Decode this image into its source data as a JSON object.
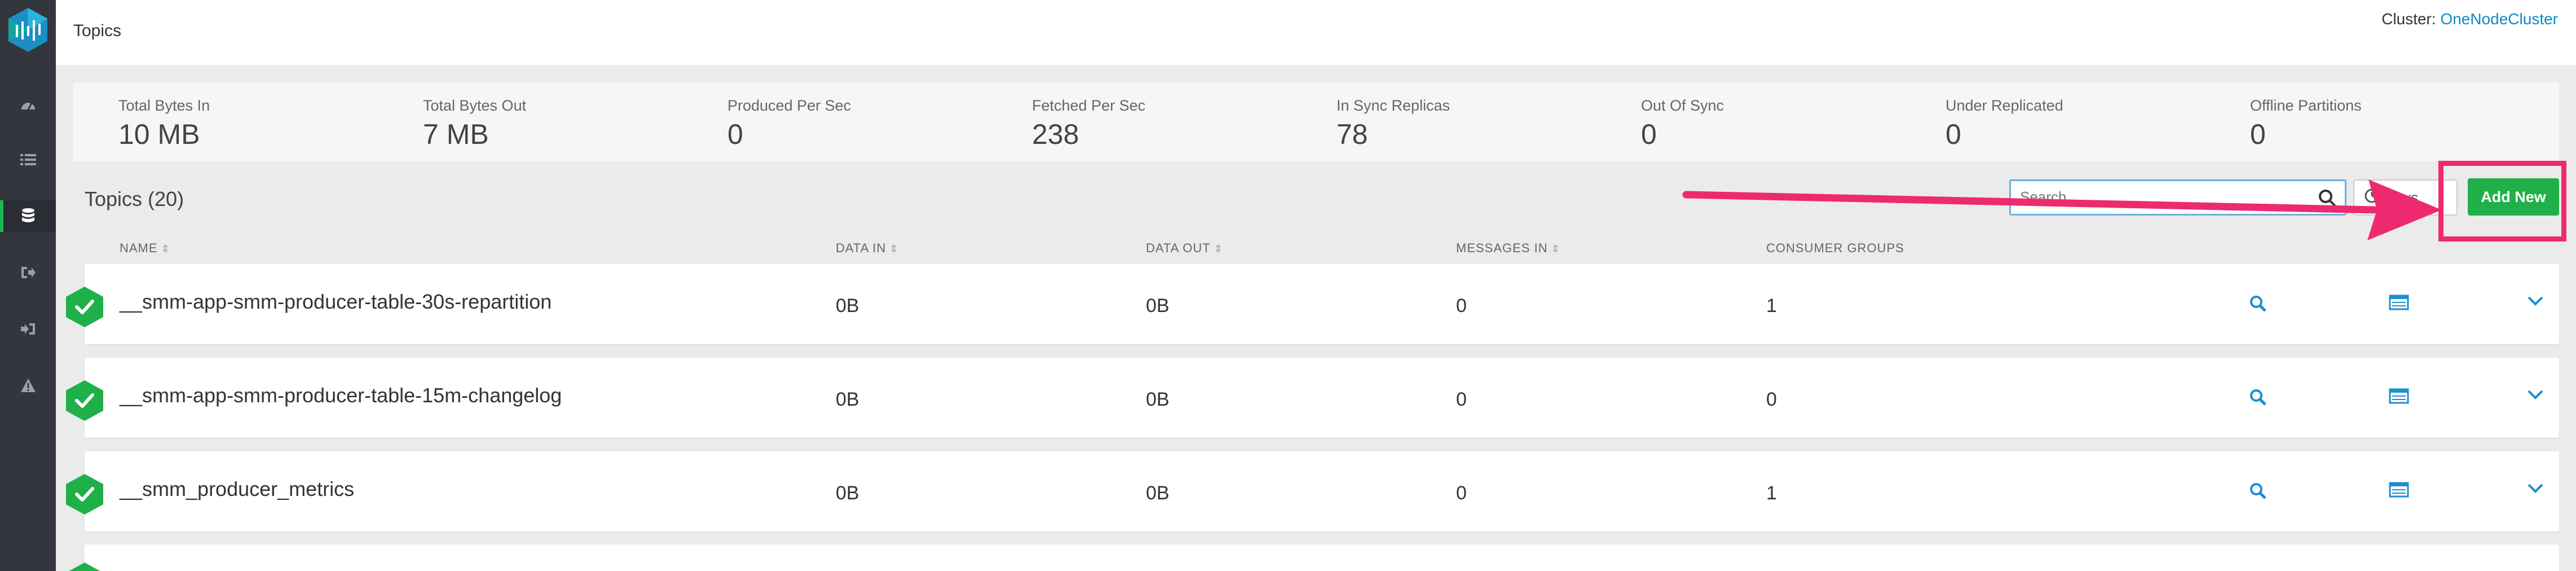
{
  "header": {
    "title": "Topics",
    "cluster_label": "Cluster:",
    "cluster_name": "OneNodeCluster"
  },
  "metrics": [
    {
      "label": "Total Bytes In",
      "value": "10 MB"
    },
    {
      "label": "Total Bytes Out",
      "value": "7 MB"
    },
    {
      "label": "Produced Per Sec",
      "value": "0"
    },
    {
      "label": "Fetched Per Sec",
      "value": "238"
    },
    {
      "label": "In Sync Replicas",
      "value": "78"
    },
    {
      "label": "Out Of Sync",
      "value": "0"
    },
    {
      "label": "Under Replicated",
      "value": "0"
    },
    {
      "label": "Offline Partitions",
      "value": "0"
    }
  ],
  "topics": {
    "title": "Topics (20)",
    "search_placeholder": "Search",
    "filter_label": "Days",
    "add_new_label": "Add New"
  },
  "columns": {
    "name": "NAME",
    "data_in": "DATA IN",
    "data_out": "DATA OUT",
    "messages_in": "MESSAGES IN",
    "consumer_groups": "CONSUMER GROUPS"
  },
  "rows": [
    {
      "name": "__smm-app-smm-producer-table-30s-repartition",
      "data_in": "0B",
      "data_out": "0B",
      "messages_in": "0",
      "consumer_groups": "1"
    },
    {
      "name": "__smm-app-smm-producer-table-15m-changelog",
      "data_in": "0B",
      "data_out": "0B",
      "messages_in": "0",
      "consumer_groups": "0"
    },
    {
      "name": "__smm_producer_metrics",
      "data_in": "0B",
      "data_out": "0B",
      "messages_in": "0",
      "consumer_groups": "1"
    }
  ],
  "colors": {
    "accent": "#0f8ac3",
    "success": "#20b049",
    "highlight": "#ed2a6f",
    "sidebar": "#33363d"
  },
  "icons": [
    "logo-icon",
    "dashboard-icon",
    "list-icon",
    "database-icon",
    "export-icon",
    "login-icon",
    "warning-icon",
    "search-icon",
    "table-icon",
    "chevron-down-icon",
    "check-icon"
  ]
}
